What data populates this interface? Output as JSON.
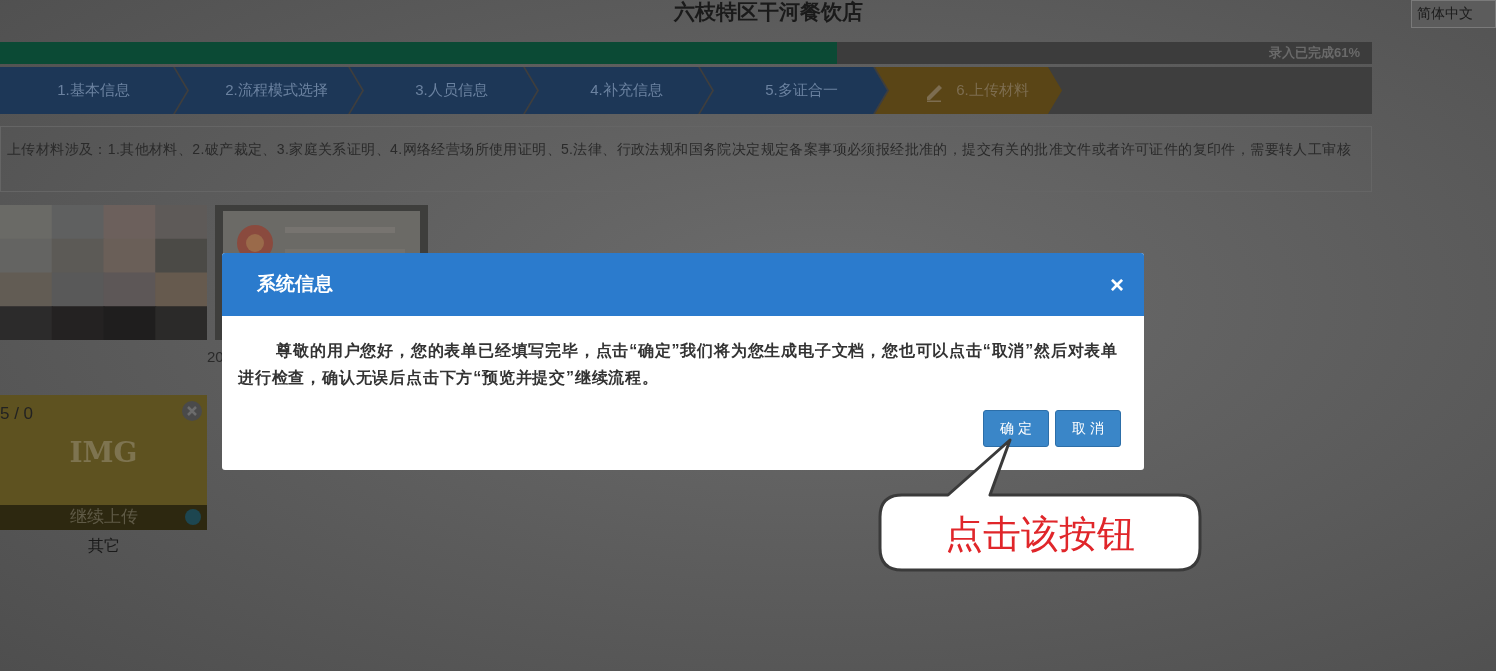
{
  "header": {
    "title": "六枝特区干河餐饮店",
    "language": "简体中文"
  },
  "progress": {
    "level": 0.61,
    "label": "录入已完成61%"
  },
  "steps": [
    {
      "label": "1.基本信息",
      "selected": false
    },
    {
      "label": "2.流程模式选择",
      "selected": false
    },
    {
      "label": "3.人员信息",
      "selected": false
    },
    {
      "label": "4.补充信息",
      "selected": false
    },
    {
      "label": "5.多证合一",
      "selected": false
    },
    {
      "label": "6.上传材料",
      "selected": true
    }
  ],
  "notice": "上传材料涉及：1.其他材料、2.破产裁定、3.家庭关系证明、4.网络经营场所使用证明、5.法律、行政法规和国务院决定规定备案事项必须报经批准的，提交有关的批准文件或者许可证件的复印件，需要转人工审核",
  "photos": [
    {
      "kind": "picture"
    },
    {
      "kind": "picture",
      "caption": "20"
    }
  ],
  "upload_card": {
    "counter": "5 / 0",
    "placeholder": "IMG",
    "action": "继续上传",
    "caption": "其它"
  },
  "dialog": {
    "title": "系统信息",
    "close": "×",
    "message": "尊敬的用户您好，您的表单已经填写完毕，点击“确定”我们将为您生成电子文档，您也可以点击“取消”然后对表单进行检查，确认无误后点击下方“预览并提交”继续流程。",
    "buttons": [
      {
        "label": "确 定"
      },
      {
        "label": "取 消"
      }
    ]
  },
  "callout": {
    "text": "点击该按钮"
  }
}
